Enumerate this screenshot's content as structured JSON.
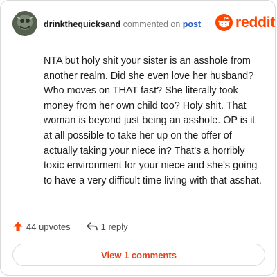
{
  "header": {
    "username": "drinkthequicksand",
    "action_text": "commented on",
    "post_link": "post"
  },
  "brand": {
    "wordmark": "reddit",
    "color": "#ff4500"
  },
  "comment": {
    "body": "NTA but holy shit your sister is an asshole from another realm. Did she even love her husband? Who moves on THAT fast? She literally took money from her own child too? Holy shit. That woman is beyond just being an asshole. OP is it at all possible to take her up on the offer of actually taking your niece in? That's a horribly toxic environment for your niece and she's going to have a very difficult time living with that asshat."
  },
  "actions": {
    "upvotes": "44 upvotes",
    "replies": "1 reply",
    "upvote_icon": "upvote-arrow-icon",
    "reply_icon": "reply-arrow-icon"
  },
  "footer": {
    "view_comments": "View 1 comments"
  },
  "colors": {
    "accent": "#e0441a",
    "link": "#2a5fc4"
  }
}
